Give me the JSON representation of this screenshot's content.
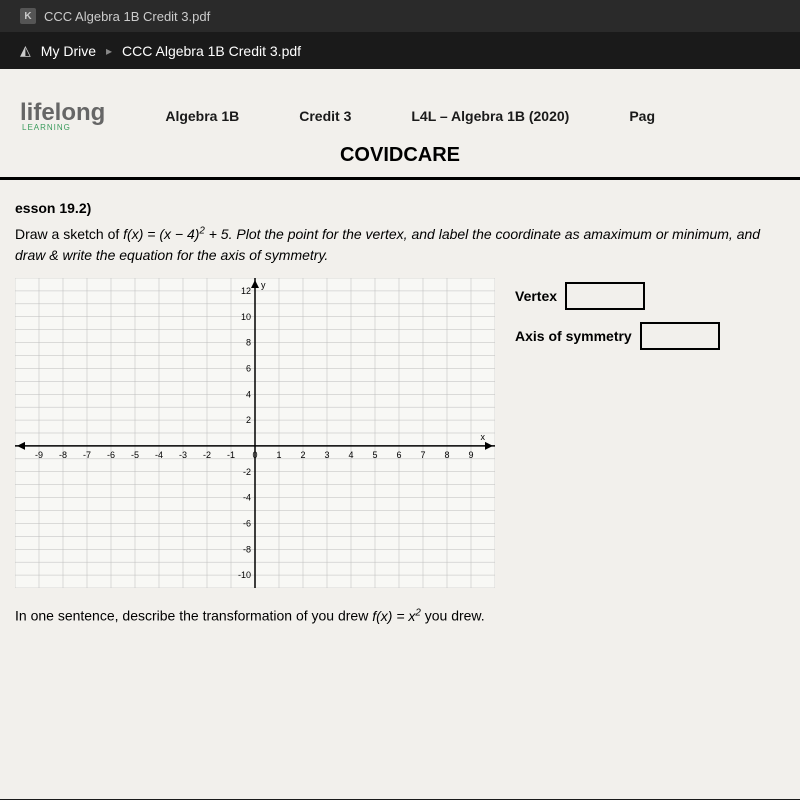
{
  "tab": {
    "icon_letter": "K",
    "title": "CCC Algebra 1B Credit 3.pdf"
  },
  "breadcrumb": {
    "drive": "My Drive",
    "file": "CCC Algebra 1B Credit 3.pdf"
  },
  "header": {
    "logo": "lifelong",
    "logo_sub": "LEARNING",
    "course": "Algebra 1B",
    "credit": "Credit 3",
    "program": "L4L – Algebra 1B (2020)",
    "page": "Pag"
  },
  "title": "COVIDCARE",
  "lesson": "esson 19.2)",
  "instruction_pre": "Draw a sketch of  ",
  "instruction_fx": "f(x)  =  (x  −  4)",
  "instruction_exp": "2",
  "instruction_post": "  +  5. Plot the point for the vertex, and label the coordinate as amaximum or minimum, and draw & write the equation for the axis of symmetry.",
  "answers": {
    "vertex_label": "Vertex",
    "axis_label": "Axis of symmetry"
  },
  "final_question_pre": "In one sentence, describe the transformation of you drew  ",
  "final_fx": "f(x)  =  x",
  "final_exp": "2",
  "final_question_post": " you drew.",
  "chart_data": {
    "type": "grid",
    "x_ticks": [
      -9,
      -8,
      -7,
      -6,
      -5,
      -4,
      -3,
      -2,
      -1,
      0,
      1,
      2,
      3,
      4,
      5,
      6,
      7,
      8,
      9
    ],
    "y_ticks": [
      -10,
      -8,
      -6,
      -4,
      -2,
      2,
      4,
      6,
      8,
      10,
      12
    ],
    "xlabel": "x",
    "ylabel": "y",
    "xlim": [
      -10,
      10
    ],
    "ylim": [
      -11,
      13
    ]
  }
}
